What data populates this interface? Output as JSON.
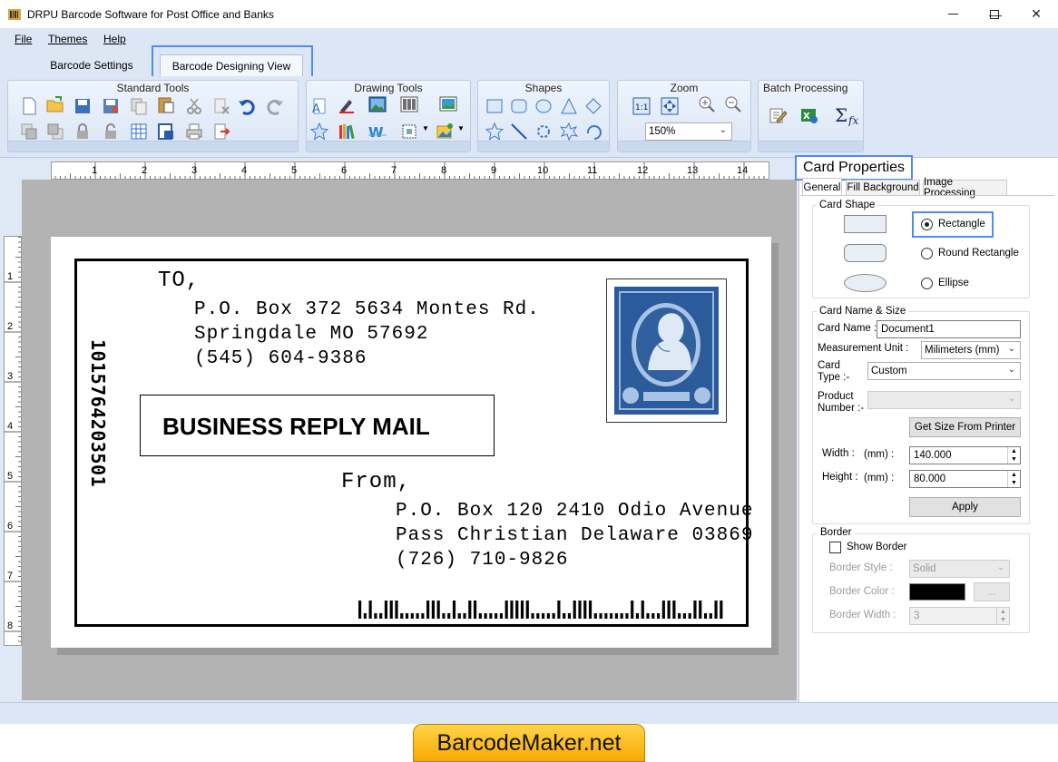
{
  "window": {
    "title": "DRPU Barcode Software for Post Office and Banks",
    "minimize": "—",
    "maximize": "☐",
    "close": "✕"
  },
  "menu": [
    {
      "label": "File"
    },
    {
      "label": "Themes"
    },
    {
      "label": "Help"
    }
  ],
  "tabs": [
    {
      "label": "Barcode Settings",
      "active": false
    },
    {
      "label": "Barcode Designing View",
      "active": true
    }
  ],
  "ribbon": {
    "groups": [
      {
        "title": "Standard Tools"
      },
      {
        "title": "Drawing Tools"
      },
      {
        "title": "Shapes"
      },
      {
        "title": "Zoom",
        "zoom_value": "150%"
      },
      {
        "title": "Batch Processing"
      }
    ]
  },
  "ruler": {
    "h_ticks": [
      "1",
      "2",
      "3",
      "4",
      "5",
      "6",
      "7",
      "8",
      "9",
      "10",
      "11",
      "12",
      "13",
      "14"
    ],
    "v_ticks": [
      "1",
      "2",
      "3",
      "4",
      "5",
      "6",
      "7",
      "8"
    ]
  },
  "card": {
    "to_label": "TO,",
    "to_line1": "P.O. Box 372 5634 Montes Rd.",
    "to_line2": "Springdale MO 57692",
    "to_line3": "(545) 604-9386",
    "brm": "BUSINESS REPLY MAIL",
    "from_label": "From,",
    "from_line1": "P.O. Box 120 2410 Odio Avenue",
    "from_line2": "Pass Christian Delaware 03869",
    "from_line3": "(726) 710-9826",
    "vertical_barcode_text": "1015764203501"
  },
  "properties": {
    "title": "Card Properties",
    "tabs": [
      "General",
      "Fill Background",
      "Image Processing"
    ],
    "card_shape": {
      "legend": "Card Shape",
      "options": [
        "Rectangle",
        "Round Rectangle",
        "Ellipse"
      ],
      "selected": "Rectangle"
    },
    "name_size": {
      "legend": "Card  Name & Size",
      "card_name_label": "Card Name :",
      "card_name_value": "Document1",
      "measurement_label": "Measurement Unit :",
      "measurement_value": "Milimeters (mm)",
      "card_type_label_1": "Card",
      "card_type_label_2": "Type :-",
      "card_type_value": "Custom",
      "product_label_1": "Product",
      "product_label_2": "Number :-",
      "get_size_button": "Get Size From Printer",
      "width_label": "Width :",
      "height_label": "Height :",
      "unit_label": "(mm) :",
      "width_value": "140.000",
      "height_value": "80.000",
      "apply_button": "Apply"
    },
    "border": {
      "legend": "Border",
      "show_border": "Show Border",
      "style_label": "Border Style :",
      "style_value": "Solid",
      "color_label": "Border Color :",
      "color_value": "#000000",
      "dots_button": "...",
      "width_label": "Border Width :",
      "width_value": "3"
    }
  },
  "brand": "BarcodeMaker.net"
}
